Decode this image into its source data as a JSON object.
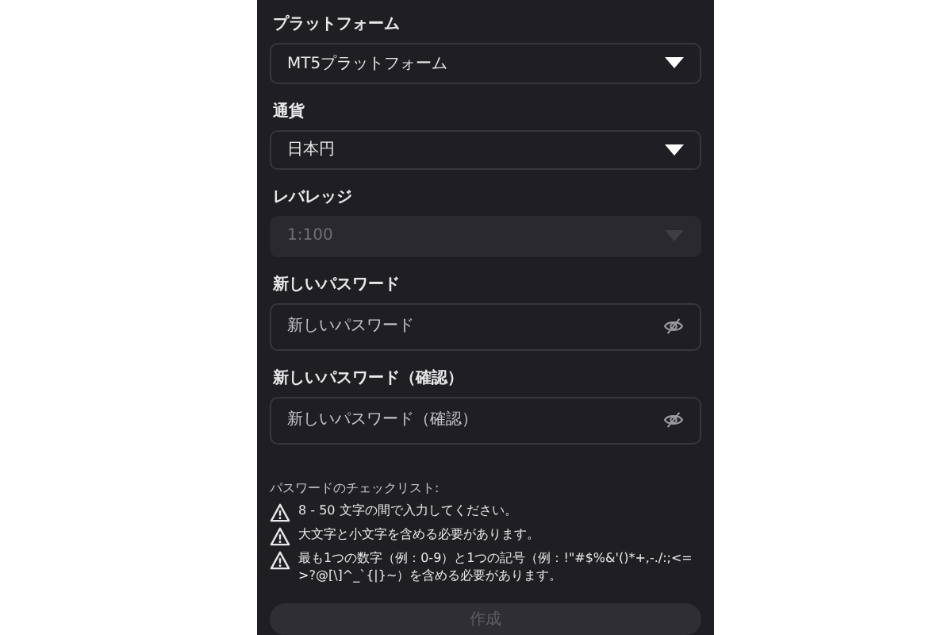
{
  "fields": [
    {
      "kind": "select",
      "label": "プラットフォーム",
      "value": "MT5プラットフォーム",
      "disabled": false
    },
    {
      "kind": "select",
      "label": "通貨",
      "value": "日本円",
      "disabled": false
    },
    {
      "kind": "select",
      "label": "レバレッジ",
      "value": "1:100",
      "disabled": true
    },
    {
      "kind": "password",
      "label": "新しいパスワード",
      "placeholder": "新しいパスワード",
      "disabled": false
    },
    {
      "kind": "password",
      "label": "新しいパスワード（確認）",
      "placeholder": "新しいパスワード（確認）",
      "disabled": false
    }
  ],
  "checklist": {
    "title": "パスワードのチェックリスト:",
    "items": [
      "8 - 50 文字の間で入力してください。",
      "大文字と小文字を含める必要があります。",
      "最も1つの数字（例：0-9）と1つの記号（例：!\"#$%&'()*+,-./:;<=>?@[\\]^_`{|}~）を含める必要があります。"
    ]
  },
  "submit": {
    "label": "作成",
    "disabled": true
  }
}
